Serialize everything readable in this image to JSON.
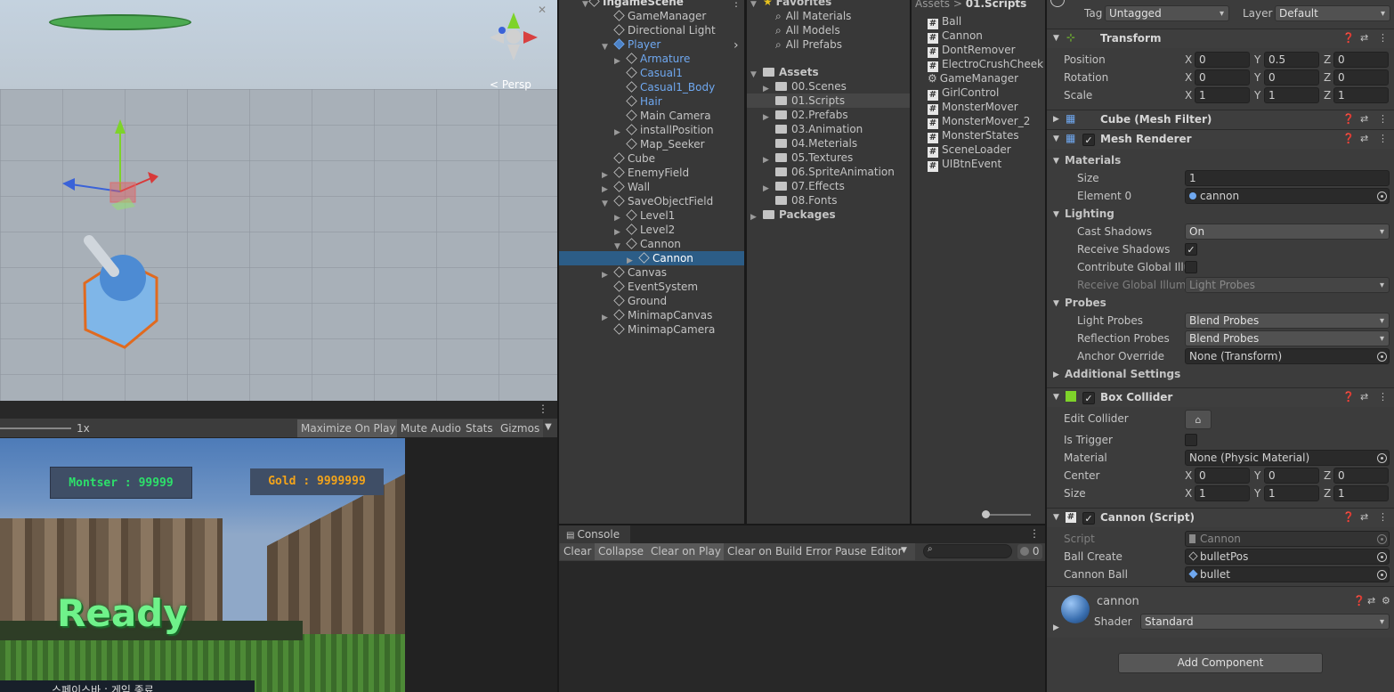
{
  "scene": {
    "persp_label": "< Persp"
  },
  "game_view": {
    "zoom": "1x",
    "buttons": [
      "Maximize On Play",
      "Mute Audio",
      "Stats",
      "Gizmos"
    ],
    "hud_monster": "Montser : 99999",
    "hud_gold": "Gold : 9999999",
    "ready_text": "Ready",
    "bottom_text": "스페이스바 : 게임 종료"
  },
  "hierarchy": {
    "scene_name": "IngameScene",
    "items": [
      {
        "label": "GameManager",
        "indent": 0,
        "expand": "",
        "blue": false
      },
      {
        "label": "Directional Light",
        "indent": 0,
        "expand": "",
        "blue": false
      },
      {
        "label": "Player",
        "indent": 0,
        "expand": "open",
        "blue": true
      },
      {
        "label": "Armature",
        "indent": 1,
        "expand": "closed",
        "blue": true
      },
      {
        "label": "Casual1",
        "indent": 1,
        "expand": "",
        "blue": true
      },
      {
        "label": "Casual1_Body",
        "indent": 1,
        "expand": "",
        "blue": true
      },
      {
        "label": "Hair",
        "indent": 1,
        "expand": "",
        "blue": true
      },
      {
        "label": "Main Camera",
        "indent": 1,
        "expand": "",
        "blue": false
      },
      {
        "label": "installPosition",
        "indent": 1,
        "expand": "closed",
        "blue": false
      },
      {
        "label": "Map_Seeker",
        "indent": 1,
        "expand": "",
        "blue": false
      },
      {
        "label": "Cube",
        "indent": 0,
        "expand": "",
        "blue": false
      },
      {
        "label": "EnemyField",
        "indent": 0,
        "expand": "closed",
        "blue": false
      },
      {
        "label": "Wall",
        "indent": 0,
        "expand": "closed",
        "blue": false
      },
      {
        "label": "SaveObjectField",
        "indent": 0,
        "expand": "open",
        "blue": false
      },
      {
        "label": "Level1",
        "indent": 1,
        "expand": "closed",
        "blue": false
      },
      {
        "label": "Level2",
        "indent": 1,
        "expand": "closed",
        "blue": false
      },
      {
        "label": "Cannon",
        "indent": 1,
        "expand": "open",
        "blue": false
      },
      {
        "label": "Cannon",
        "indent": 2,
        "expand": "closed",
        "blue": false,
        "selected": true
      },
      {
        "label": "Canvas",
        "indent": 0,
        "expand": "closed",
        "blue": false
      },
      {
        "label": "EventSystem",
        "indent": 0,
        "expand": "",
        "blue": false
      },
      {
        "label": "Ground",
        "indent": 0,
        "expand": "",
        "blue": false
      },
      {
        "label": "MinimapCanvas",
        "indent": 0,
        "expand": "closed",
        "blue": false
      },
      {
        "label": "MinimapCamera",
        "indent": 0,
        "expand": "",
        "blue": false
      }
    ]
  },
  "project": {
    "favorites_label": "Favorites",
    "favorites": [
      "All Materials",
      "All Models",
      "All Prefabs"
    ],
    "assets_label": "Assets",
    "folders": [
      {
        "label": "00.Scenes",
        "arrow": true
      },
      {
        "label": "01.Scripts",
        "arrow": false,
        "selected": true
      },
      {
        "label": "02.Prefabs",
        "arrow": true
      },
      {
        "label": "03.Animation",
        "arrow": false
      },
      {
        "label": "04.Meterials",
        "arrow": false
      },
      {
        "label": "05.Textures",
        "arrow": true
      },
      {
        "label": "06.SpriteAnimation",
        "arrow": false
      },
      {
        "label": "07.Effects",
        "arrow": true
      },
      {
        "label": "08.Fonts",
        "arrow": false
      }
    ],
    "packages_label": "Packages",
    "breadcrumb_root": "Assets",
    "breadcrumb_sep": ">",
    "breadcrumb_current": "01.Scripts",
    "scripts": [
      {
        "label": "Ball",
        "icon": "#"
      },
      {
        "label": "Cannon",
        "icon": "#"
      },
      {
        "label": "DontRemover",
        "icon": "#"
      },
      {
        "label": "ElectroCrushCheek",
        "icon": "#"
      },
      {
        "label": "GameManager",
        "icon": "gear"
      },
      {
        "label": "GirlControl",
        "icon": "#"
      },
      {
        "label": "MonsterMover",
        "icon": "#"
      },
      {
        "label": "MonsterMover_2",
        "icon": "#"
      },
      {
        "label": "MonsterStates",
        "icon": "#"
      },
      {
        "label": "SceneLoader",
        "icon": "#"
      },
      {
        "label": "UIBtnEvent",
        "icon": "#"
      }
    ]
  },
  "console": {
    "tab": "Console",
    "buttons": [
      "Clear",
      "Collapse",
      "Clear on Play",
      "Clear on Build",
      "Error Pause",
      "Editor"
    ],
    "count": "0"
  },
  "inspector": {
    "tag_label": "Tag",
    "tag_value": "Untagged",
    "layer_label": "Layer",
    "layer_value": "Default",
    "transform": {
      "title": "Transform",
      "position": {
        "label": "Position",
        "x": "0",
        "y": "0.5",
        "z": "0"
      },
      "rotation": {
        "label": "Rotation",
        "x": "0",
        "y": "0",
        "z": "0"
      },
      "scale": {
        "label": "Scale",
        "x": "1",
        "y": "1",
        "z": "1"
      }
    },
    "mesh_filter": {
      "title": "Cube (Mesh Filter)"
    },
    "mesh_renderer": {
      "title": "Mesh Renderer",
      "materials": "Materials",
      "size_label": "Size",
      "size_value": "1",
      "element0_label": "Element 0",
      "element0_value": "cannon",
      "lighting": "Lighting",
      "cast_shadows_label": "Cast Shadows",
      "cast_shadows_value": "On",
      "receive_shadows_label": "Receive Shadows",
      "contribute_gi_label": "Contribute Global Illur",
      "receive_gi_label": "Receive Global Illumin",
      "receive_gi_value": "Light Probes",
      "probes": "Probes",
      "light_probes_label": "Light Probes",
      "light_probes_value": "Blend Probes",
      "reflection_probes_label": "Reflection Probes",
      "reflection_probes_value": "Blend Probes",
      "anchor_override_label": "Anchor Override",
      "anchor_override_value": "None (Transform)",
      "additional_settings": "Additional Settings"
    },
    "box_collider": {
      "title": "Box Collider",
      "edit_collider": "Edit Collider",
      "is_trigger": "Is Trigger",
      "material_label": "Material",
      "material_value": "None (Physic Material)",
      "center": {
        "label": "Center",
        "x": "0",
        "y": "0",
        "z": "0"
      },
      "size": {
        "label": "Size",
        "x": "1",
        "y": "1",
        "z": "1"
      }
    },
    "cannon_script": {
      "title": "Cannon (Script)",
      "script_label": "Script",
      "script_value": "Cannon",
      "ball_create_label": "Ball Create",
      "ball_create_value": "bulletPos",
      "cannon_ball_label": "Cannon Ball",
      "cannon_ball_value": "bullet"
    },
    "material": {
      "name": "cannon",
      "shader_label": "Shader",
      "shader_value": "Standard"
    },
    "add_component": "Add Component"
  }
}
